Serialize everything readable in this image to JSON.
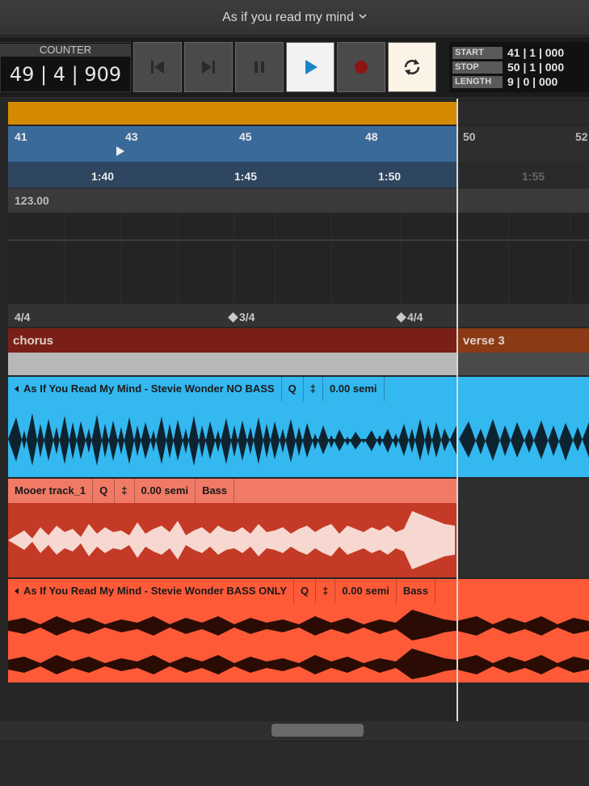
{
  "window": {
    "title": "As if you read my mind"
  },
  "transport": {
    "counter_label": "COUNTER",
    "counter_value": "49 | 4 | 909",
    "buttons": {
      "rewind": "skip-back-icon",
      "forward": "skip-forward-icon",
      "pause": "pause-icon",
      "play": "play-icon",
      "record": "record-icon",
      "loop": "loop-icon"
    },
    "position": {
      "start_label": "START",
      "start_value": "41 | 1 | 000",
      "stop_label": "STOP",
      "stop_value": "50 | 1 | 000",
      "length_label": "LENGTH",
      "length_value": "9 | 0 | 000"
    }
  },
  "ruler": {
    "bars": [
      "41",
      "43",
      "45",
      "48",
      "50",
      "52"
    ],
    "times": [
      "1:40",
      "1:45",
      "1:50",
      "1:55"
    ]
  },
  "tempo": "123.00",
  "time_signatures": [
    "4/4",
    "3/4",
    "4/4"
  ],
  "markers": [
    "chorus",
    "verse 3"
  ],
  "tracks": [
    {
      "name": "As If You Read My Mind - Stevie Wonder NO BASS",
      "q": "Q",
      "transpose": "0.00 semi",
      "instrument": ""
    },
    {
      "name": "Mooer track_1",
      "q": "Q",
      "transpose": "0.00 semi",
      "instrument": "Bass"
    },
    {
      "name": "As If You Read My Mind - Stevie Wonder BASS ONLY",
      "q": "Q",
      "transpose": "0.00 semi",
      "instrument": "Bass"
    }
  ],
  "colors": {
    "loop_region": "#d48a00",
    "ruler_selected": "#3a6a9a",
    "track1": "#33b8f0",
    "track2": "#f07a66",
    "track3": "#ff5a38",
    "chorus": "#7a1f17",
    "verse": "#8a3a14"
  }
}
